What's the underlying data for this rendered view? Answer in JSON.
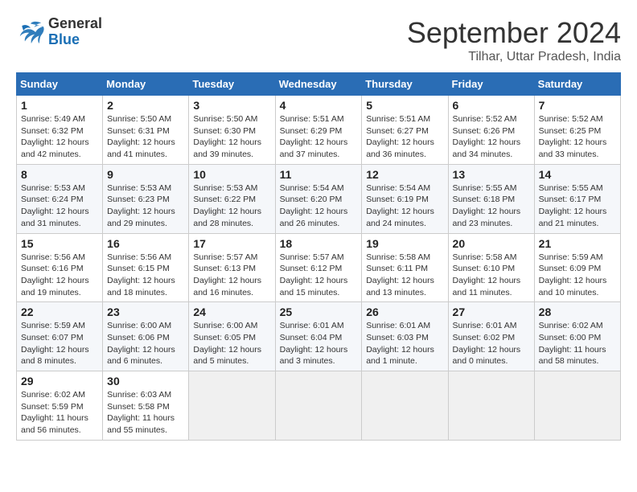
{
  "header": {
    "logo_line1": "General",
    "logo_line2": "Blue",
    "month": "September 2024",
    "location": "Tilhar, Uttar Pradesh, India"
  },
  "weekdays": [
    "Sunday",
    "Monday",
    "Tuesday",
    "Wednesday",
    "Thursday",
    "Friday",
    "Saturday"
  ],
  "weeks": [
    [
      {
        "day": "1",
        "info": "Sunrise: 5:49 AM\nSunset: 6:32 PM\nDaylight: 12 hours\nand 42 minutes."
      },
      {
        "day": "2",
        "info": "Sunrise: 5:50 AM\nSunset: 6:31 PM\nDaylight: 12 hours\nand 41 minutes."
      },
      {
        "day": "3",
        "info": "Sunrise: 5:50 AM\nSunset: 6:30 PM\nDaylight: 12 hours\nand 39 minutes."
      },
      {
        "day": "4",
        "info": "Sunrise: 5:51 AM\nSunset: 6:29 PM\nDaylight: 12 hours\nand 37 minutes."
      },
      {
        "day": "5",
        "info": "Sunrise: 5:51 AM\nSunset: 6:27 PM\nDaylight: 12 hours\nand 36 minutes."
      },
      {
        "day": "6",
        "info": "Sunrise: 5:52 AM\nSunset: 6:26 PM\nDaylight: 12 hours\nand 34 minutes."
      },
      {
        "day": "7",
        "info": "Sunrise: 5:52 AM\nSunset: 6:25 PM\nDaylight: 12 hours\nand 33 minutes."
      }
    ],
    [
      {
        "day": "8",
        "info": "Sunrise: 5:53 AM\nSunset: 6:24 PM\nDaylight: 12 hours\nand 31 minutes."
      },
      {
        "day": "9",
        "info": "Sunrise: 5:53 AM\nSunset: 6:23 PM\nDaylight: 12 hours\nand 29 minutes."
      },
      {
        "day": "10",
        "info": "Sunrise: 5:53 AM\nSunset: 6:22 PM\nDaylight: 12 hours\nand 28 minutes."
      },
      {
        "day": "11",
        "info": "Sunrise: 5:54 AM\nSunset: 6:20 PM\nDaylight: 12 hours\nand 26 minutes."
      },
      {
        "day": "12",
        "info": "Sunrise: 5:54 AM\nSunset: 6:19 PM\nDaylight: 12 hours\nand 24 minutes."
      },
      {
        "day": "13",
        "info": "Sunrise: 5:55 AM\nSunset: 6:18 PM\nDaylight: 12 hours\nand 23 minutes."
      },
      {
        "day": "14",
        "info": "Sunrise: 5:55 AM\nSunset: 6:17 PM\nDaylight: 12 hours\nand 21 minutes."
      }
    ],
    [
      {
        "day": "15",
        "info": "Sunrise: 5:56 AM\nSunset: 6:16 PM\nDaylight: 12 hours\nand 19 minutes."
      },
      {
        "day": "16",
        "info": "Sunrise: 5:56 AM\nSunset: 6:15 PM\nDaylight: 12 hours\nand 18 minutes."
      },
      {
        "day": "17",
        "info": "Sunrise: 5:57 AM\nSunset: 6:13 PM\nDaylight: 12 hours\nand 16 minutes."
      },
      {
        "day": "18",
        "info": "Sunrise: 5:57 AM\nSunset: 6:12 PM\nDaylight: 12 hours\nand 15 minutes."
      },
      {
        "day": "19",
        "info": "Sunrise: 5:58 AM\nSunset: 6:11 PM\nDaylight: 12 hours\nand 13 minutes."
      },
      {
        "day": "20",
        "info": "Sunrise: 5:58 AM\nSunset: 6:10 PM\nDaylight: 12 hours\nand 11 minutes."
      },
      {
        "day": "21",
        "info": "Sunrise: 5:59 AM\nSunset: 6:09 PM\nDaylight: 12 hours\nand 10 minutes."
      }
    ],
    [
      {
        "day": "22",
        "info": "Sunrise: 5:59 AM\nSunset: 6:07 PM\nDaylight: 12 hours\nand 8 minutes."
      },
      {
        "day": "23",
        "info": "Sunrise: 6:00 AM\nSunset: 6:06 PM\nDaylight: 12 hours\nand 6 minutes."
      },
      {
        "day": "24",
        "info": "Sunrise: 6:00 AM\nSunset: 6:05 PM\nDaylight: 12 hours\nand 5 minutes."
      },
      {
        "day": "25",
        "info": "Sunrise: 6:01 AM\nSunset: 6:04 PM\nDaylight: 12 hours\nand 3 minutes."
      },
      {
        "day": "26",
        "info": "Sunrise: 6:01 AM\nSunset: 6:03 PM\nDaylight: 12 hours\nand 1 minute."
      },
      {
        "day": "27",
        "info": "Sunrise: 6:01 AM\nSunset: 6:02 PM\nDaylight: 12 hours\nand 0 minutes."
      },
      {
        "day": "28",
        "info": "Sunrise: 6:02 AM\nSunset: 6:00 PM\nDaylight: 11 hours\nand 58 minutes."
      }
    ],
    [
      {
        "day": "29",
        "info": "Sunrise: 6:02 AM\nSunset: 5:59 PM\nDaylight: 11 hours\nand 56 minutes."
      },
      {
        "day": "30",
        "info": "Sunrise: 6:03 AM\nSunset: 5:58 PM\nDaylight: 11 hours\nand 55 minutes."
      },
      {
        "day": "",
        "info": ""
      },
      {
        "day": "",
        "info": ""
      },
      {
        "day": "",
        "info": ""
      },
      {
        "day": "",
        "info": ""
      },
      {
        "day": "",
        "info": ""
      }
    ]
  ]
}
